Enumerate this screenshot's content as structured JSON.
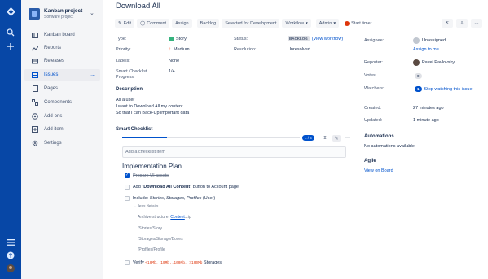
{
  "global_nav": {
    "icons": [
      "jira-logo-icon",
      "search-icon",
      "create-icon",
      "menu-icon",
      "help-icon",
      "avatar"
    ]
  },
  "project": {
    "name": "Kanban project",
    "type": "Software project"
  },
  "sidebar": {
    "items": [
      {
        "label": "Kanban board",
        "icon": "board-icon"
      },
      {
        "label": "Reports",
        "icon": "reports-icon"
      },
      {
        "label": "Releases",
        "icon": "releases-icon"
      },
      {
        "label": "Issues",
        "icon": "issues-icon",
        "active": true
      },
      {
        "label": "Pages",
        "icon": "pages-icon"
      },
      {
        "label": "Components",
        "icon": "components-icon"
      },
      {
        "label": "Add-ons",
        "icon": "addons-icon"
      },
      {
        "label": "Add item",
        "icon": "add-item-icon"
      },
      {
        "label": "Settings",
        "icon": "settings-icon"
      }
    ]
  },
  "issue": {
    "title": "Download All",
    "toolbar": {
      "edit": "Edit",
      "comment": "Comment",
      "assign": "Assign",
      "backlog": "Backlog",
      "selected": "Selected for Development",
      "workflow": "Workflow",
      "admin": "Admin",
      "start_timer": "Start timer"
    },
    "details": {
      "type_label": "Type:",
      "type_value": "Story",
      "priority_label": "Priority:",
      "priority_value": "Medium",
      "labels_label": "Labels:",
      "labels_value": "None",
      "scp_label": "Smart Checklist Progress:",
      "scp_value": "1/4",
      "status_label": "Status:",
      "status_value": "BACKLOG",
      "view_workflow": "(View workflow)",
      "resolution_label": "Resolution:",
      "resolution_value": "Unresolved"
    },
    "description": {
      "heading": "Description",
      "lines": [
        "As a user",
        "I want to Download All my content",
        "So that I can Back-Up important data"
      ]
    }
  },
  "checklist": {
    "heading": "Smart Checklist",
    "progress_label": "1 / 4",
    "progress_fraction": 0.25,
    "placeholder": "Add a checklist item",
    "section_title": "Implementation Plan",
    "item1": "Prepare UI assets",
    "item2_pre": "Add \"",
    "item2_bold": "Download All Content",
    "item2_post": "\" button to Account page",
    "item3_pre": "Include: ",
    "item3_em": "Stories, Storages, Profiles",
    "item3_post": " (User)",
    "less_details": "less details",
    "archive_pre": "Archive structure: ",
    "archive_link": "Content",
    "archive_post": ".zip",
    "path1": "/Stories/Story",
    "path2": "/Storages/Storage/Boxes",
    "path3": "/Profiles/Profile",
    "item4_pre": "Verify ",
    "item4_code": "<10Mb, 10Mb..100Mb, >100Mb",
    "item4_post": " Storages"
  },
  "people": {
    "assignee_label": "Assignee:",
    "assignee_value": "Unassigned",
    "assign_to_me": "Assign to me",
    "reporter_label": "Reporter:",
    "reporter_value": "Pavel Pavlovsky",
    "votes_label": "Votes:",
    "votes_value": "0",
    "watchers_label": "Watchers:",
    "watchers_value": "1",
    "stop_watching": "Stop watching this issue"
  },
  "dates": {
    "created_label": "Created:",
    "created_value": "27 minutes ago",
    "updated_label": "Updated:",
    "updated_value": "1 minute ago"
  },
  "automations": {
    "heading": "Automations",
    "text": "No automations available."
  },
  "agile": {
    "heading": "Agile",
    "link": "View on Board"
  }
}
